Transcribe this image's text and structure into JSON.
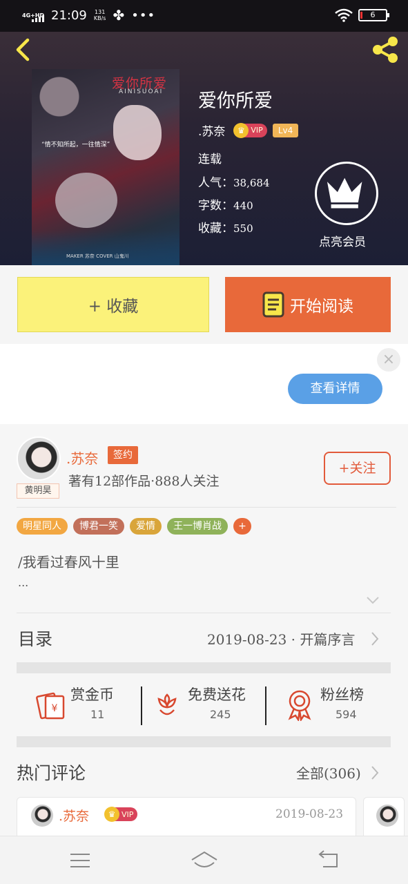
{
  "status_bar": {
    "network": "4G+HD",
    "time": "21:09",
    "speed_value": "131",
    "speed_unit": "KB/s",
    "battery": "6"
  },
  "book": {
    "title": "爱你所爱",
    "author": ".苏奈",
    "vip_label": "VIP",
    "level": "Lv4",
    "status": "连载",
    "popularity_label": "人气：",
    "popularity": "38,684",
    "words_label": "字数：",
    "words": "440",
    "favorites_label": "收藏：",
    "favorites": "550",
    "member_label": "点亮会员",
    "cover": {
      "title": "爱你所爱",
      "subtitle": "AINISUOAI",
      "quote": "“情不知所起，一往情深”",
      "credit": "MAKER 苏奈    COVER 山鬼川"
    }
  },
  "actions": {
    "favorite_label": "+ 收藏",
    "read_label": "开始阅读"
  },
  "ad": {
    "close": "×",
    "detail_label": "查看详情"
  },
  "author_card": {
    "name": ".苏奈",
    "sign_label": "签约",
    "avatar_tag": "黄明昊",
    "stats": "著有12部作品·888人关注",
    "follow_label": "+关注"
  },
  "tags": [
    {
      "label": "明星同人",
      "color": "#f2a742"
    },
    {
      "label": "博君一笑",
      "color": "#c2705a"
    },
    {
      "label": "爱情",
      "color": "#d9a53a"
    },
    {
      "label": "王一博肖战",
      "color": "#8fb25a"
    },
    {
      "label": "+",
      "color": "#e8693a"
    }
  ],
  "intro": {
    "line1": "/我看过春风十里",
    "line2": "..."
  },
  "toc": {
    "label": "目录",
    "latest": "2019-08-23 · 开篇序言"
  },
  "stats": [
    {
      "label": "赏金币",
      "value": "11",
      "icon": "red-envelope-icon"
    },
    {
      "label": "免费送花",
      "value": "245",
      "icon": "flower-icon"
    },
    {
      "label": "粉丝榜",
      "value": "594",
      "icon": "medal-icon"
    }
  ],
  "comments": {
    "label": "热门评论",
    "all_label": "全部(306)",
    "first": {
      "name": ".苏奈",
      "vip_label": "VIP",
      "date": "2019-08-23"
    }
  },
  "colors": {
    "accent": "#e8693a",
    "favorite_button": "#fbf27a",
    "detail_button": "#5aa0e6"
  }
}
